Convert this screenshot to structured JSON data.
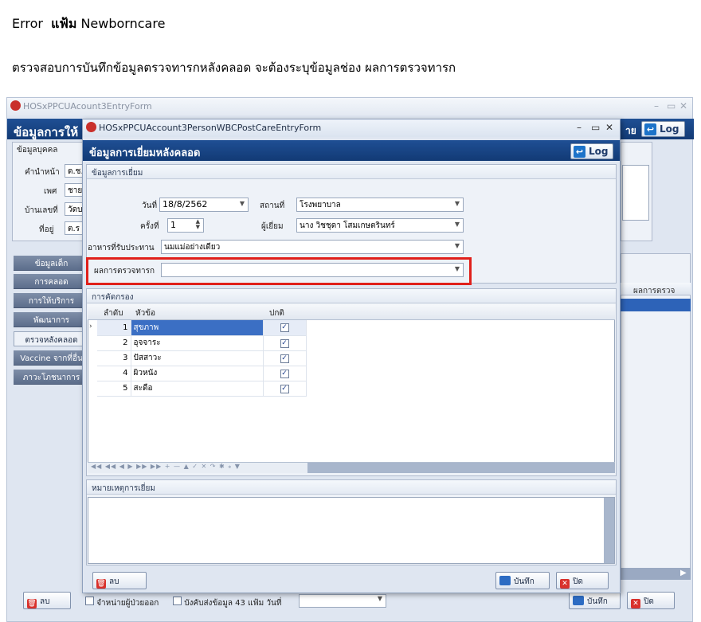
{
  "doc": {
    "error_word": "Error",
    "file_word": "แฟ้ม",
    "file_name": "Newborncare",
    "instruction": "ตรวจสอบการบันทึกข้อมูลตรวจทารกหลังคลอด จะต้องระบุข้อมูลช่อง ผลการตรวจทารก"
  },
  "back": {
    "title": "HOSxPPCUAcount3EntryForm",
    "header": "ข้อมูลการให้",
    "header_right_text": "าย",
    "log_label": "Log",
    "group_label": "ข้อมูลบุคคล",
    "fields": [
      {
        "label": "คำนำหน้า",
        "value": "ด.ช."
      },
      {
        "label": "เพศ",
        "value": "ชาย"
      },
      {
        "label": "บ้านเลขที่",
        "value": "วัดบ"
      },
      {
        "label": "ที่อยู่",
        "value": "ต.ร"
      }
    ],
    "tabs": [
      "ข้อมูลเด็ก",
      "การคลอด",
      "การให้บริการ",
      "พัฒนาการ",
      "ตรวจหลังคลอด",
      "Vaccine จากที่อื่น",
      "ภาวะโภชนาการ"
    ],
    "selected_tab": "ตรวจหลังคลอด",
    "right_col_header": "ผลการตรวจ",
    "bottom": {
      "delete_label": "ลบ",
      "check1": "จำหน่ายผู้ป่วยออก",
      "check2": "บังคับส่งข้อมูล 43 แฟ้ม วันที่",
      "save_label": "บันทึก",
      "close_label": "ปิด"
    }
  },
  "front": {
    "title": "HOSxPPCUAccount3PersonWBCPostCareEntryForm",
    "header": "ข้อมูลการเยี่ยมหลังคลอด",
    "log_label": "Log",
    "group_label": "ข้อมูลการเยี่ยม",
    "date_label": "วันที่",
    "date_value": "18/8/2562",
    "place_label": "สถานที่",
    "place_value": "โรงพยาบาล",
    "times_label": "ครั้งที่",
    "times_value": "1",
    "visitor_label": "ผู้เยี่ยม",
    "visitor_value": "นาง วิชชุดา โสมเกษตรินทร์",
    "food_label": "อาหารที่รับประทาน",
    "food_value": "นมแม่อย่างเดียว",
    "result_label": "ผลการตรวจทารก",
    "result_value": "",
    "screen_group_label": "การคัดกรอง",
    "grid_headers": {
      "seq": "ลำดับ",
      "topic": "หัวข้อ",
      "normal": "ปกติ"
    },
    "grid_rows": [
      {
        "seq": "1",
        "topic": "สุขภาพ",
        "normal": "✓"
      },
      {
        "seq": "2",
        "topic": "อุจจาระ",
        "normal": "✓"
      },
      {
        "seq": "3",
        "topic": "ปัสสาวะ",
        "normal": "✓"
      },
      {
        "seq": "4",
        "topic": "ผิวหนัง",
        "normal": "✓"
      },
      {
        "seq": "5",
        "topic": "สะดือ",
        "normal": "✓"
      }
    ],
    "navigator": "◀◀ ◀◀ ◀ ▶ ▶▶ ▶▶ + — ▲ ✓ ✕ ↷ ✱ ⁎ ▼",
    "notes_label": "หมายเหตุการเยี่ยม",
    "notes_value": "",
    "delete_label": "ลบ",
    "save_label": "บันทึก",
    "close_label": "ปิด",
    "highlight_color": "#e0201b"
  }
}
